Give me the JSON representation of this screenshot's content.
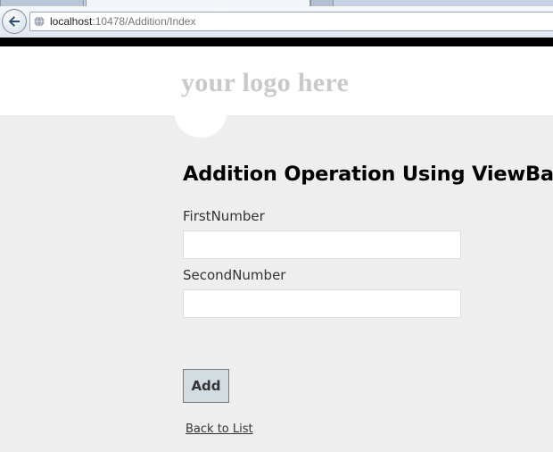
{
  "browser": {
    "url_host": "localhost",
    "url_path": ":10478/Addition/Index"
  },
  "header": {
    "logo_text": "your logo here"
  },
  "form": {
    "title": "Addition Operation Using ViewBag",
    "first_label": "FirstNumber",
    "first_value": "",
    "second_label": "SecondNumber",
    "second_value": "",
    "add_label": "Add"
  },
  "links": {
    "back_label": "Back to List"
  },
  "icons": {
    "back": "back-arrow-icon",
    "site": "globe-icon"
  },
  "colors": {
    "page_bg": "#eeeeee",
    "logo": "#c9c9c9",
    "button_bg": "#d3dde1"
  }
}
